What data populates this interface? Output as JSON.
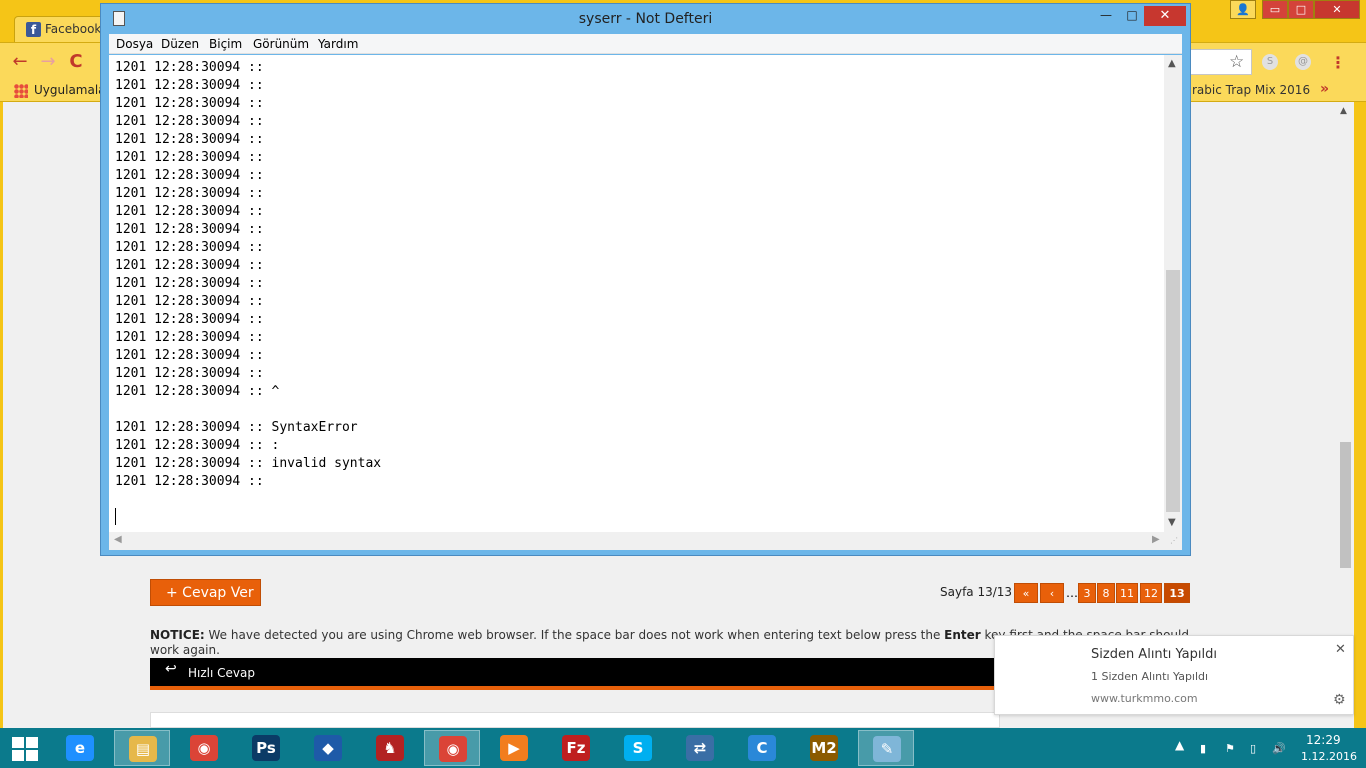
{
  "browser": {
    "tab_title": "Facebook",
    "tab_icon": "facebook-icon",
    "bookmarks": {
      "apps_label": "Uygulamalar",
      "trap_label": "rabic Trap Mix 2016",
      "more": "»"
    },
    "nav": {
      "back": "←",
      "forward": "→",
      "reload": "C"
    },
    "star": "☆",
    "menu": "⋮",
    "window_controls": {
      "user": "👤",
      "minimize": "▭",
      "maximize": "□",
      "close": "✕"
    }
  },
  "forum": {
    "reply_button": "+ Cevap Ver",
    "page_label": "Sayfa 13/13",
    "pagination": {
      "first": "«",
      "prev": "‹",
      "dots": "…",
      "pages": [
        "3",
        "8",
        "11",
        "12",
        "13"
      ]
    },
    "notice_label": "NOTICE:",
    "notice_text_a": " We have detected you are using Chrome web browser. If the space bar does not work when entering text below press the ",
    "notice_enter": "Enter",
    "notice_text_b": " key first and the space bar should work again.",
    "quick_reply_title": "Hızlı Cevap"
  },
  "notification": {
    "title": "Sizden Alıntı Yapıldı",
    "body": "1 Sizden Alıntı Yapıldı",
    "site": "www.turkmmo.com",
    "close": "✕",
    "settings": "⚙"
  },
  "notepad": {
    "title": "syserr - Not Defteri",
    "window_controls": {
      "minimize": "—",
      "maximize": "□",
      "close": "✕"
    },
    "menu": [
      "Dosya",
      "Düzen",
      "Biçim",
      "Görünüm",
      "Yardım"
    ],
    "lines": [
      "1201 12:28:30094 ::",
      "1201 12:28:30094 ::",
      "1201 12:28:30094 ::",
      "1201 12:28:30094 ::",
      "1201 12:28:30094 ::",
      "1201 12:28:30094 ::",
      "1201 12:28:30094 ::",
      "1201 12:28:30094 ::",
      "1201 12:28:30094 ::",
      "1201 12:28:30094 ::",
      "1201 12:28:30094 ::",
      "1201 12:28:30094 ::",
      "1201 12:28:30094 ::",
      "1201 12:28:30094 ::",
      "1201 12:28:30094 ::",
      "1201 12:28:30094 ::",
      "1201 12:28:30094 ::",
      "1201 12:28:30094 ::",
      "1201 12:28:30094 :: ^",
      "",
      "1201 12:28:30094 :: SyntaxError",
      "1201 12:28:30094 :: :",
      "1201 12:28:30094 :: invalid syntax",
      "1201 12:28:30094 ::"
    ]
  },
  "taskbar": {
    "apps": [
      {
        "name": "internet-explorer",
        "glyph": "e",
        "color": "#1e90ff"
      },
      {
        "name": "file-explorer",
        "glyph": "▤",
        "color": "#e6b84a"
      },
      {
        "name": "chrome",
        "glyph": "◉",
        "color": "#db4437"
      },
      {
        "name": "photoshop",
        "glyph": "Ps",
        "color": "#0b3b66"
      },
      {
        "name": "virtualbox",
        "glyph": "◆",
        "color": "#1e5aa8"
      },
      {
        "name": "game-app",
        "glyph": "♞",
        "color": "#b22222"
      },
      {
        "name": "chrome-2",
        "glyph": "◉",
        "color": "#db4437"
      },
      {
        "name": "media-player",
        "glyph": "▶",
        "color": "#f27d1e"
      },
      {
        "name": "filezilla",
        "glyph": "Fz",
        "color": "#bf1f1f"
      },
      {
        "name": "skype",
        "glyph": "S",
        "color": "#00aff0"
      },
      {
        "name": "network-tool",
        "glyph": "⇄",
        "color": "#3a6ea5"
      },
      {
        "name": "ccleaner",
        "glyph": "C",
        "color": "#2a88d8"
      },
      {
        "name": "metin2",
        "glyph": "M2",
        "color": "#8b5a00"
      },
      {
        "name": "notepad",
        "glyph": "✎",
        "color": "#7fb6d8"
      }
    ],
    "tray": {
      "up_arrow": "▲",
      "signal": "▮",
      "flag": "⚑",
      "battery": "▯",
      "volume": "🔊"
    },
    "clock_time": "12:29",
    "clock_date": "1.12.2016"
  }
}
